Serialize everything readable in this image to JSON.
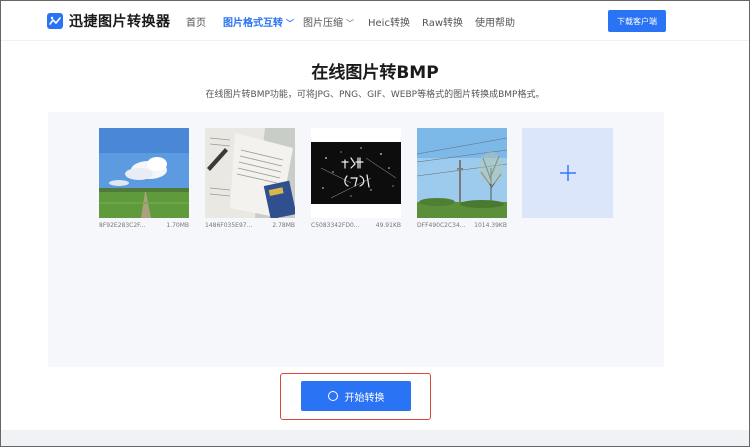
{
  "header": {
    "logo_text": "迅捷图片转换器",
    "nav": [
      {
        "label": "首页",
        "active": false
      },
      {
        "label": "图片格式互转",
        "active": true,
        "dropdown": true
      },
      {
        "label": "图片压缩",
        "active": false,
        "dropdown": true
      },
      {
        "label": "Heic转换",
        "active": false
      },
      {
        "label": "Raw转换",
        "active": false
      },
      {
        "label": "使用帮助",
        "active": false
      }
    ],
    "download_button": "下载客户端"
  },
  "main": {
    "title": "在线图片转BMP",
    "subtitle": "在线图片转BMP功能，可将JPG、PNG、GIF、WEBP等格式的图片转换成BMP格式。",
    "files": [
      {
        "name": "8F92E283C2F...",
        "size": "1.70MB",
        "thumb": "sky-field"
      },
      {
        "name": "1486F035E97...",
        "size": "2.78MB",
        "thumb": "documents"
      },
      {
        "name": "C5083342FD0...",
        "size": "49.91KB",
        "thumb": "night-sparkle"
      },
      {
        "name": "DFF490C2C34...",
        "size": "1014.39KB",
        "thumb": "tree-poles"
      }
    ],
    "add_icon": "plus-icon",
    "start_button": "开始转换"
  },
  "colors": {
    "accent": "#2b73f5",
    "highlight_outline": "#d9483b",
    "workspace_bg": "#f6f7fa",
    "add_tile_bg": "#dbe6fb"
  }
}
